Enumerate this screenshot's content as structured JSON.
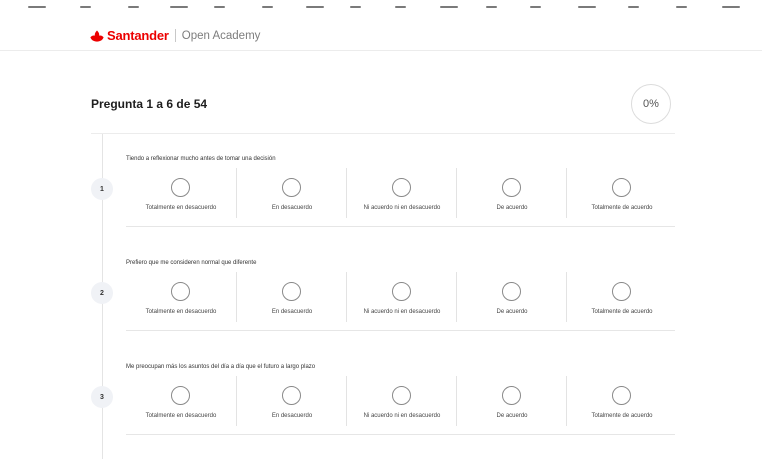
{
  "header": {
    "brand": "Santander",
    "product": "Open Academy",
    "brand_color": "#ec0000",
    "logo_icon": "santander-flame-icon"
  },
  "quiz": {
    "title": "Pregunta 1 a 6 de 54",
    "progress": "0%",
    "progress_value": 0
  },
  "scale_labels": [
    "Totalmente en desacuerdo",
    "En desacuerdo",
    "Ni acuerdo ni en desacuerdo",
    "De acuerdo",
    "Totalmente de acuerdo"
  ],
  "questions": [
    {
      "number": "1",
      "text": "Tiendo a reflexionar mucho antes de tomar una decisión"
    },
    {
      "number": "2",
      "text": "Prefiero que me consideren normal que diferente"
    },
    {
      "number": "3",
      "text": "Me preocupan más los asuntos del día a día que el futuro a largo plazo"
    }
  ]
}
